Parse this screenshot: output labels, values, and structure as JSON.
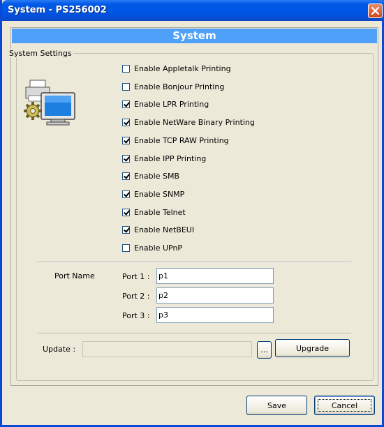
{
  "window": {
    "title": "System - PS256002"
  },
  "header": {
    "title": "System"
  },
  "group": {
    "label": "System Settings"
  },
  "options": [
    {
      "label": "Enable Appletalk Printing",
      "checked": false
    },
    {
      "label": "Enable Bonjour Printing",
      "checked": false
    },
    {
      "label": "Enable LPR Printing",
      "checked": true
    },
    {
      "label": "Enable NetWare Binary Printing",
      "checked": true
    },
    {
      "label": "Enable TCP RAW Printing",
      "checked": true
    },
    {
      "label": "Enable IPP Printing",
      "checked": true
    },
    {
      "label": "Enable SMB",
      "checked": true
    },
    {
      "label": "Enable SNMP",
      "checked": true
    },
    {
      "label": "Enable Telnet",
      "checked": true
    },
    {
      "label": "Enable NetBEUI",
      "checked": true
    },
    {
      "label": "Enable UPnP",
      "checked": false
    }
  ],
  "ports": {
    "section_label": "Port Name",
    "items": [
      {
        "label": "Port 1 :",
        "value": "p1"
      },
      {
        "label": "Port 2 :",
        "value": "p2"
      },
      {
        "label": "Port 3 :",
        "value": "p3"
      }
    ]
  },
  "update": {
    "label": "Update :",
    "value": "",
    "browse_label": "...",
    "upgrade_label": "Upgrade"
  },
  "footer": {
    "save_label": "Save",
    "cancel_label": "Cancel"
  },
  "icons": {
    "close": "close-icon",
    "system": "printer-computer-gear-icon"
  },
  "colors": {
    "titlebar": "#0055e5",
    "header_bar": "#4ea0f9",
    "close": "#d2451e",
    "face": "#ece9d8"
  }
}
